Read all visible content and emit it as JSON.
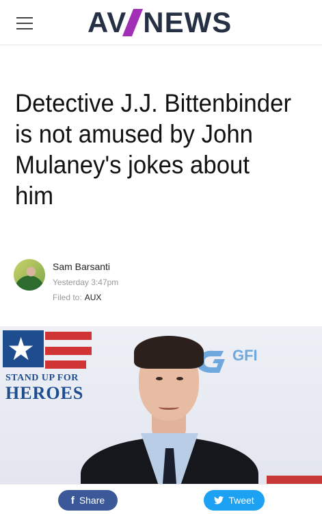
{
  "header": {
    "menu_icon": "hamburger-menu-icon",
    "logo_left": "AV",
    "logo_right": "NEWS",
    "brand_color": "#a12fb6"
  },
  "article": {
    "headline": "Detective J.J. Bittenbinder is not amused by John Mulaney's jokes about him",
    "author": "Sam Barsanti",
    "date": "Yesterday 3:47pm",
    "filed_label": "Filed to:",
    "filed_value": "AUX"
  },
  "hero": {
    "backdrop_small": "STAND UP FOR",
    "backdrop_big": "HEROES",
    "backdrop_logo": "GFI"
  },
  "share": {
    "share_label": "Share",
    "share_icon": "facebook-icon",
    "share_color": "#3b5998",
    "tweet_label": "Tweet",
    "tweet_icon": "twitter-bird-icon",
    "tweet_color": "#1da1f2"
  }
}
